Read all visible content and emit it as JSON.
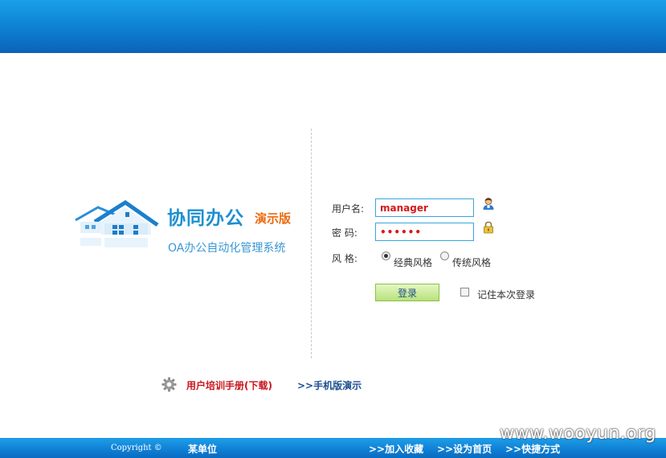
{
  "logo": {
    "title": "协同办公",
    "tag": "演示版",
    "subtitle": "OA办公自动化管理系统",
    "icon": "house-icon"
  },
  "form": {
    "username_label": "用户名:",
    "username_value": "manager",
    "password_label": "密  码:",
    "password_value": "••••••",
    "style_label": "风  格:",
    "style_options": [
      "经典风格",
      "传统风格"
    ],
    "style_selected": "经典风格",
    "login_button": "登录",
    "remember_label": "记住本次登录",
    "user_icon": "user-icon",
    "lock_icon": "lock-icon"
  },
  "links": {
    "manual": "用户培训手册(下载)",
    "mobile": ">>手机版演示",
    "manual_icon": "gear-icon"
  },
  "footer": {
    "copyright": "Copyright ©",
    "company": "某单位",
    "add_favorite": ">>加入收藏",
    "set_homepage": ">>设为首页",
    "shortcut": ">>快捷方式"
  },
  "watermark": "www.wooyun.org",
  "colors": {
    "header_blue": "#0d7fd1",
    "accent_orange": "#ec6a10",
    "link_red": "#c8161d",
    "link_blue": "#1d4f91",
    "input_text_red": "#d61a1a",
    "button_green": "#b7e27a"
  }
}
